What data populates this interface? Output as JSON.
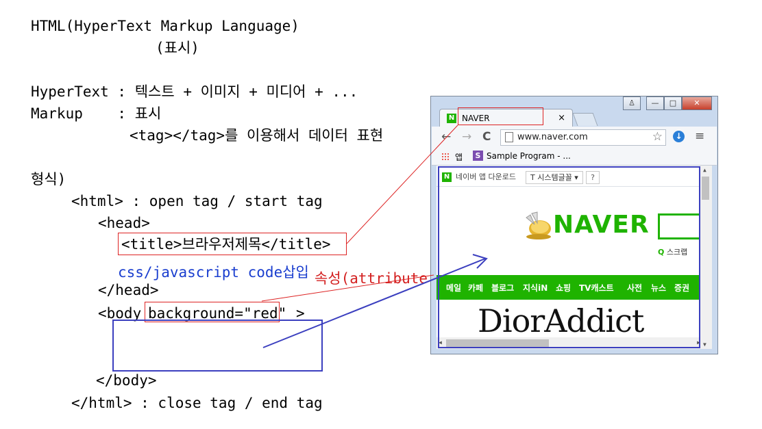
{
  "lines": {
    "l1": "HTML(HyperText Markup Language)",
    "l2": "(표시)",
    "l3": "HyperText : 텍스트 + 이미지 + 미디어 + ...",
    "l4": "Markup    : 표시",
    "l5": "<tag></tag>를 이용해서 데이터 표현",
    "l6": "형식)",
    "l7": "<html> : open tag / start tag",
    "l8": "<head>",
    "l9": "<title>브라우저제목</title>",
    "l10": "css/javascript code삽입",
    "l11": "</head>",
    "l12": "<body ",
    "l12_attr": "background=\"red\"",
    "l12_end": ">",
    "l13": "</body>",
    "l14": "</html> : close tag / end tag",
    "attribute_note": "속성(attribute)"
  },
  "browser": {
    "tab_title": "NAVER",
    "tab_close": "×",
    "tab_favicon": "N",
    "url": "www.naver.com",
    "back": "←",
    "forward": "→",
    "reload": "C",
    "star": "☆",
    "download": "↓",
    "menu": "≡",
    "win_user": "♙",
    "win_min": "—",
    "win_max": "□",
    "win_close": "✕",
    "bookmark_apps": "앱",
    "bookmark_s": "S",
    "bookmark_sample": "Sample Program - ...",
    "naver_app_n": "N",
    "naver_app": "네이버 앱 다운로드",
    "system_font": "T 시스템글꼴 ▾",
    "help": "?",
    "logo_text": "NAVER",
    "scrap_prefix": "Q",
    "scrap": "스크랩",
    "menu_items": [
      "메일",
      "카페",
      "블로그",
      "지식iN",
      "쇼핑",
      "TV캐스트",
      "사전",
      "뉴스",
      "증권"
    ],
    "ad_text": "DiorAddict",
    "scroll_up": "▲",
    "scroll_down": "▼",
    "scroll_left": "◀",
    "scroll_right": "▶"
  },
  "colors": {
    "annot_red": "#d32020",
    "annot_blue": "#3b3fbf",
    "code_blue": "#1a3ecf",
    "naver_green": "#1fb300"
  }
}
